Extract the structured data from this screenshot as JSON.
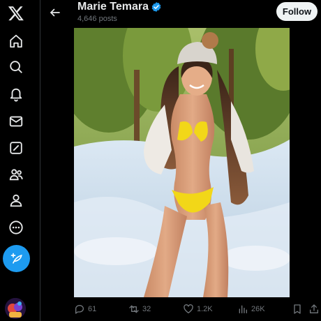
{
  "app": {
    "logo_icon": "x-logo-icon"
  },
  "sidebar": {
    "items": [
      {
        "name": "home",
        "icon": "home-icon"
      },
      {
        "name": "explore",
        "icon": "search-icon"
      },
      {
        "name": "notifications",
        "icon": "bell-icon"
      },
      {
        "name": "messages",
        "icon": "envelope-icon"
      },
      {
        "name": "grok",
        "icon": "grok-icon"
      },
      {
        "name": "communities",
        "icon": "people-icon"
      },
      {
        "name": "profile",
        "icon": "person-icon"
      },
      {
        "name": "more",
        "icon": "more-circle-icon"
      }
    ],
    "compose_icon": "feather-plus-icon"
  },
  "header": {
    "profile_name": "Marie Temara",
    "verified": true,
    "post_count": "4,646 posts",
    "follow_label": "Follow"
  },
  "post": {
    "media_description_icon": "photo",
    "actions": {
      "replies": "61",
      "reposts": "32",
      "likes": "1.2K",
      "views": "26K"
    }
  },
  "colors": {
    "background": "#000000",
    "text": "#e7e9ea",
    "muted": "#71767b",
    "accent": "#1d9bf0",
    "follow_bg": "#eff3f4"
  }
}
